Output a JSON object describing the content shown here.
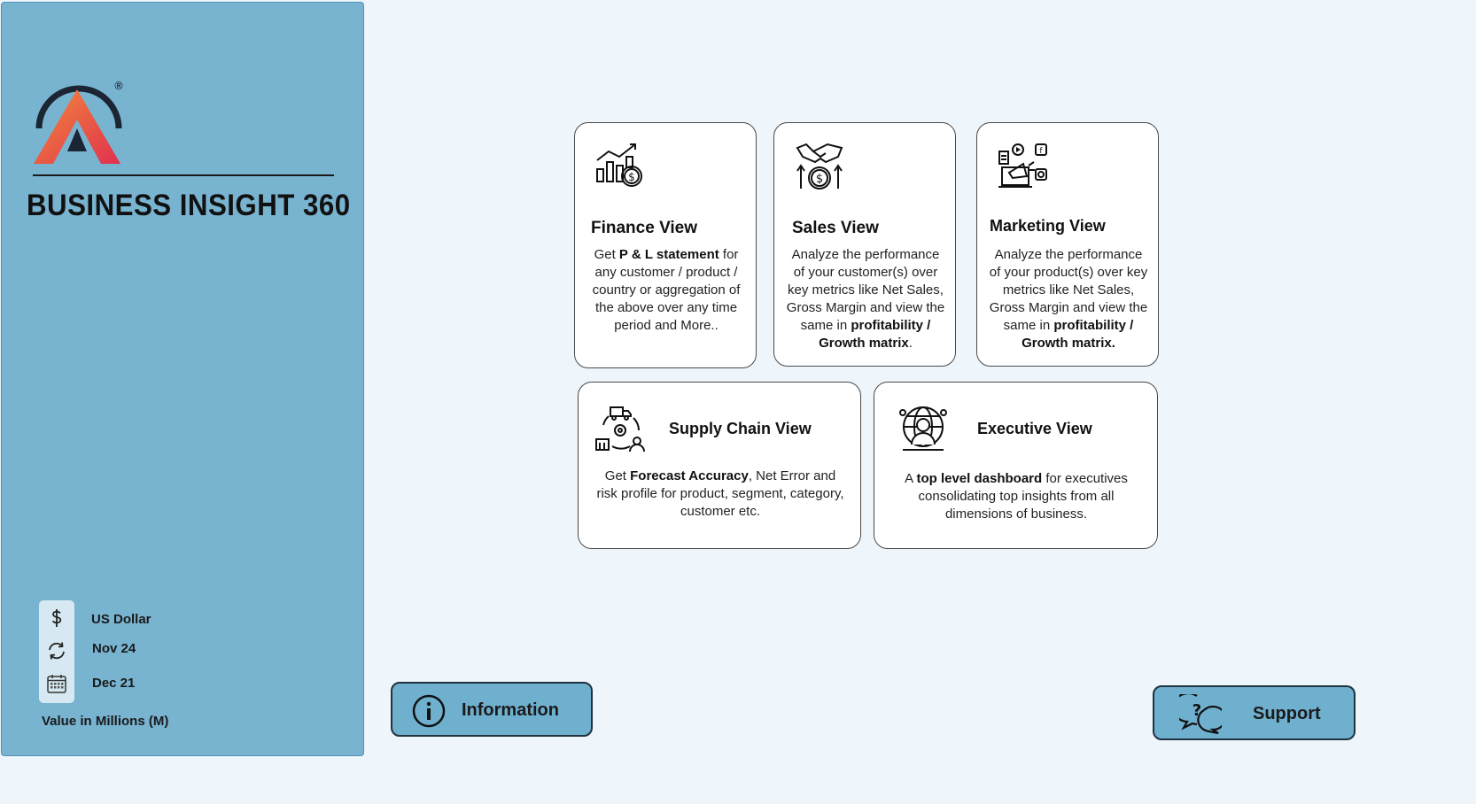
{
  "app": {
    "title": "BUSINESS INSIGHT 360",
    "registered_mark": "®"
  },
  "filters": {
    "currency": "US Dollar",
    "refresh_date": "Nov 24",
    "data_start": "Dec 21",
    "unit_note": "Value in Millions (M)"
  },
  "cards": {
    "finance": {
      "title": "Finance View",
      "desc_pre": "Get ",
      "desc_bold": "P & L statement",
      "desc_post": " for any customer / product / country or aggregation of the above over any time period and More.."
    },
    "sales": {
      "title": "Sales View",
      "desc_pre": "Analyze the performance of your customer(s) over key metrics like Net Sales, Gross Margin and view the same in ",
      "desc_bold": "profitability / Growth matrix",
      "desc_post": "."
    },
    "marketing": {
      "title": "Marketing View",
      "desc_pre": "Analyze the performance of your product(s) over key metrics like Net Sales, Gross Margin and view the same in ",
      "desc_bold": "profitability / Growth matrix.",
      "desc_post": ""
    },
    "supply_chain": {
      "title": "Supply Chain View",
      "desc_pre": "Get ",
      "desc_bold": "Forecast Accuracy",
      "desc_post": ", Net Error and risk profile for product, segment, category, customer etc."
    },
    "executive": {
      "title": "Executive View",
      "desc_pre": "A ",
      "desc_bold": "top level dashboard",
      "desc_post": " for executives consolidating top insights from all dimensions of business."
    }
  },
  "buttons": {
    "information": "Information",
    "support": "Support"
  },
  "colors": {
    "sidebar": "#78b3d0",
    "background": "#eef5fb",
    "button": "#6fb0cf",
    "logo_gradient_start": "#f07a3a",
    "logo_gradient_end": "#e0314f"
  },
  "icons": {
    "logo": "business-insight-logo",
    "currency": "dollar-icon",
    "refresh": "refresh-icon",
    "calendar": "calendar-icon",
    "finance": "finance-chart-icon",
    "sales": "handshake-dollar-icon",
    "marketing": "marketing-megaphone-icon",
    "supply_chain": "supply-chain-cycle-icon",
    "executive": "executive-globe-icon",
    "information": "info-icon",
    "support": "support-chat-icon"
  }
}
